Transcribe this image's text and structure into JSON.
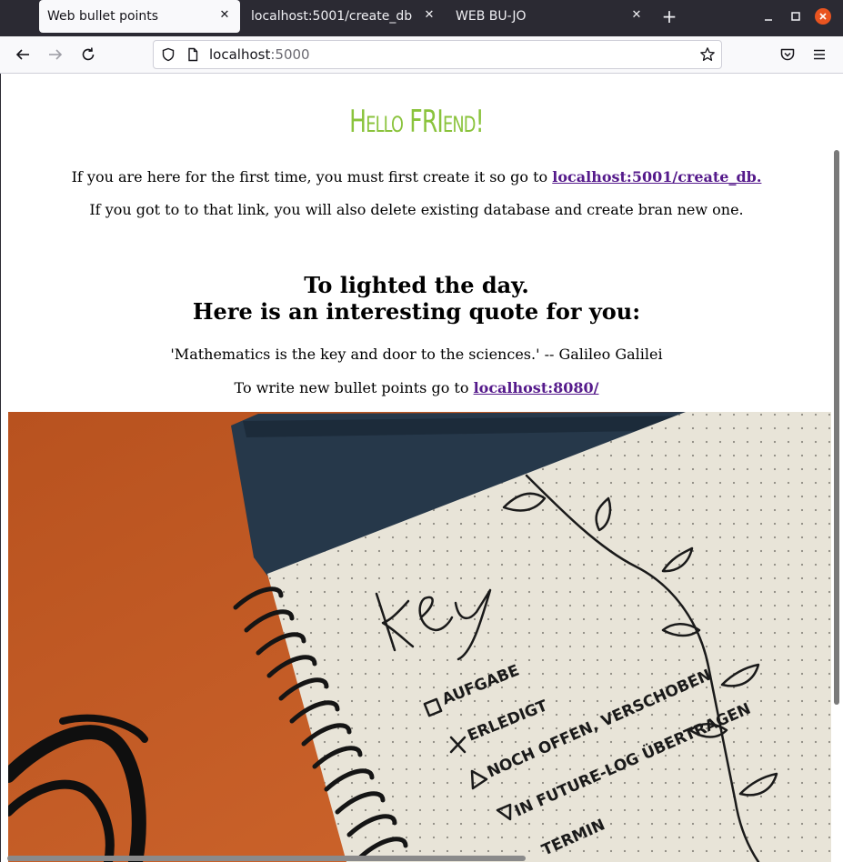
{
  "browser": {
    "tabs": [
      {
        "title": "Web bullet points",
        "active": true
      },
      {
        "title": "localhost:5001/create_db",
        "active": false
      },
      {
        "title": "WEB BU-JO",
        "active": false
      }
    ],
    "url_host": "localhost",
    "url_port": ":5000",
    "accent_close": "#e95420"
  },
  "page": {
    "greeting": "Hello FRIend!",
    "intro_line1_text": "If you are here for the first time, you must first create it so go to ",
    "intro_line1_link": "localhost:5001/create_db.",
    "intro_line2": "If you got to to that link, you will also delete existing database and create bran new one.",
    "heading_line1": "To lighted the day.",
    "heading_line2": "Here is an interesting quote for you:",
    "quote": "'Mathematics is the key and door to the sciences.' -- Galileo Galilei",
    "write_text": "To write new bullet points go to ",
    "write_link": "localhost:8080/",
    "greeting_color": "#8ac33c",
    "link_color": "#551a8b"
  },
  "photo": {
    "notebook_title": "key",
    "legend": [
      "AUFGABE",
      "ERLEDIGT",
      "NOCH OFFEN, VERSCHOBEN",
      "IN FUTURE-LOG ÜBERTRAGEN",
      "TERMIN"
    ]
  }
}
